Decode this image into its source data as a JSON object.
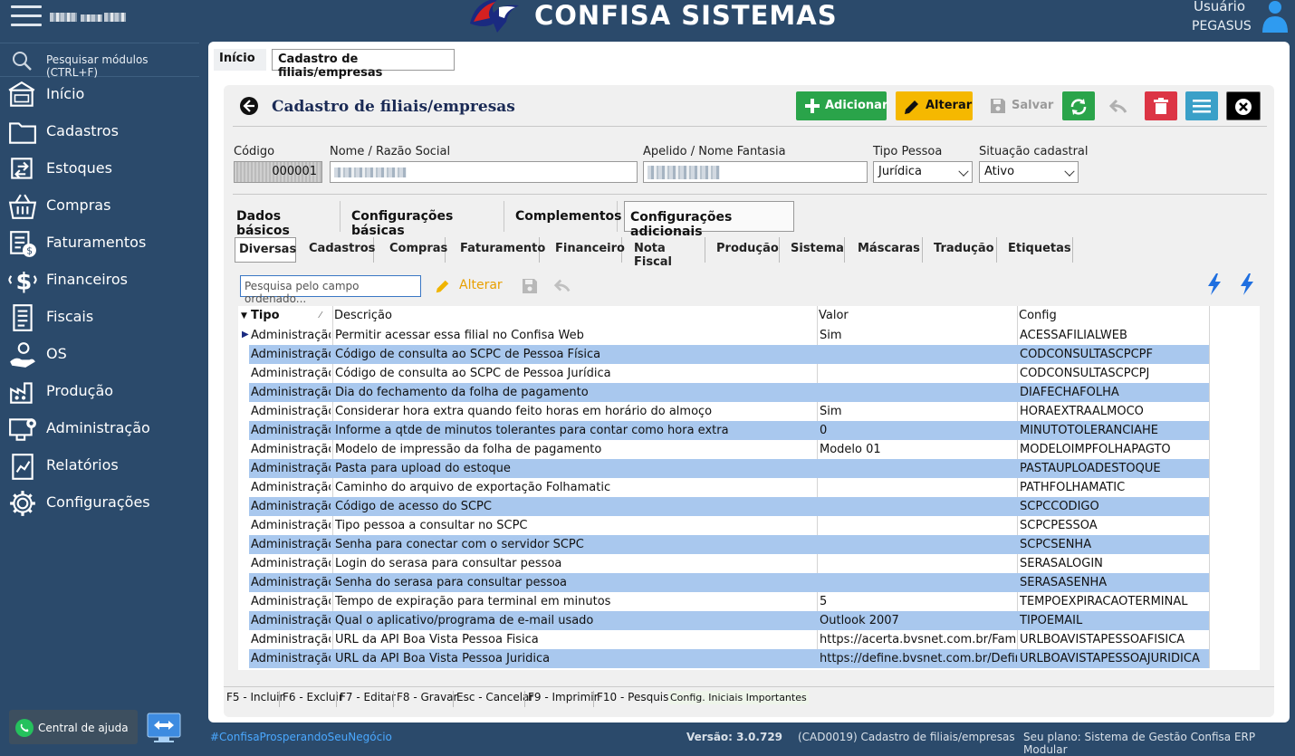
{
  "app": {
    "brand": "CONFISA SISTEMAS",
    "user_label": "Usuário",
    "user_name": "PEGASUS"
  },
  "sidebar": {
    "search_placeholder": "Pesquisar módulos (CTRL+F)",
    "items": [
      {
        "label": "Início",
        "icon": "home-icon"
      },
      {
        "label": "Cadastros",
        "icon": "folder-icon"
      },
      {
        "label": "Estoques",
        "icon": "stock-icon"
      },
      {
        "label": "Compras",
        "icon": "basket-icon"
      },
      {
        "label": "Faturamentos",
        "icon": "invoice-icon"
      },
      {
        "label": "Financeiros",
        "icon": "dollar-icon"
      },
      {
        "label": "Fiscais",
        "icon": "document-icon"
      },
      {
        "label": "OS",
        "icon": "service-order-icon"
      },
      {
        "label": "Produção",
        "icon": "factory-icon"
      },
      {
        "label": "Administração",
        "icon": "admin-icon"
      },
      {
        "label": "Relatórios",
        "icon": "report-icon"
      },
      {
        "label": "Configurações",
        "icon": "gear-icon"
      }
    ],
    "help_label": "Central de ajuda"
  },
  "tabs": {
    "home": "Início",
    "current": "Cadastro de filiais/empresas"
  },
  "page": {
    "title": "Cadastro de filiais/empresas"
  },
  "toolbar": {
    "add": "Adicionar",
    "edit": "Alterar",
    "save": "Salvar"
  },
  "colors": {
    "add": "#2aa44a",
    "edit": "#f5b800",
    "refresh": "#2aa44a",
    "delete": "#dc3545",
    "menu": "#3aa0c8",
    "close": "#000000",
    "row_alt": "#a9c8ee",
    "sidebar": "#2b4a6b"
  },
  "form": {
    "codigo_label": "Código",
    "codigo_value": "000001",
    "nome_label": "Nome / Razão Social",
    "apelido_label": "Apelido / Nome Fantasia",
    "tipo_label": "Tipo Pessoa",
    "tipo_value": "Jurídica",
    "situacao_label": "Situação cadastral",
    "situacao_value": "Ativo"
  },
  "main_tabs": [
    "Dados básicos",
    "Configurações básicas",
    "Complementos",
    "Configurações adicionais"
  ],
  "sub_tabs": [
    "Diversas",
    "Cadastros",
    "Compras",
    "Faturamento",
    "Financeiro",
    "Nota Fiscal",
    "Produção",
    "Sistema",
    "Máscaras",
    "Tradução",
    "Etiquetas"
  ],
  "grid": {
    "search_placeholder": "Pesquisa pelo campo ordenado...",
    "edit_label": "Alterar",
    "headers": {
      "tipo": "Tipo",
      "descricao": "Descrição",
      "valor": "Valor",
      "config": "Config"
    },
    "rows": [
      {
        "tipo": "Administração",
        "descricao": "Permitir acessar essa filial no Confisa Web",
        "valor": "Sim",
        "config": "ACESSAFILIALWEB"
      },
      {
        "tipo": "Administração",
        "descricao": "Código de consulta ao SCPC de Pessoa Física",
        "valor": "",
        "config": "CODCONSULTASCPCPF"
      },
      {
        "tipo": "Administração",
        "descricao": "Código de consulta ao SCPC de Pessoa Jurídica",
        "valor": "",
        "config": "CODCONSULTASCPCPJ"
      },
      {
        "tipo": "Administração",
        "descricao": "Dia do fechamento da folha de pagamento",
        "valor": "",
        "config": "DIAFECHAFOLHA"
      },
      {
        "tipo": "Administração",
        "descricao": "Considerar hora extra quando feito horas em horário do almoço",
        "valor": "Sim",
        "config": "HORAEXTRAALMOCO"
      },
      {
        "tipo": "Administração",
        "descricao": "Informe a qtde de minutos tolerantes para contar como hora extra",
        "valor": "0",
        "config": "MINUTOTOLERANCIAHE"
      },
      {
        "tipo": "Administração",
        "descricao": "Modelo de impressão da folha de pagamento",
        "valor": "Modelo 01",
        "config": "MODELOIMPFOLHAPAGTO"
      },
      {
        "tipo": "Administração",
        "descricao": "Pasta para upload do estoque",
        "valor": "",
        "config": "PASTAUPLOADESTOQUE"
      },
      {
        "tipo": "Administração",
        "descricao": "Caminho do arquivo de exportação Folhamatic",
        "valor": "",
        "config": "PATHFOLHAMATIC"
      },
      {
        "tipo": "Administração",
        "descricao": "Código de acesso do SCPC",
        "valor": "",
        "config": "SCPCCODIGO"
      },
      {
        "tipo": "Administração",
        "descricao": "Tipo pessoa a consultar no SCPC",
        "valor": "",
        "config": "SCPCPESSOA"
      },
      {
        "tipo": "Administração",
        "descricao": "Senha para conectar com o servidor SCPC",
        "valor": "",
        "config": "SCPCSENHA"
      },
      {
        "tipo": "Administração",
        "descricao": "Login do serasa para consultar pessoa",
        "valor": "",
        "config": "SERASALOGIN"
      },
      {
        "tipo": "Administração",
        "descricao": "Senha do serasa para consultar pessoa",
        "valor": "",
        "config": "SERASASENHA"
      },
      {
        "tipo": "Administração",
        "descricao": "Tempo de expiração para terminal em minutos",
        "valor": "5",
        "config": "TEMPOEXPIRACAOTERMINAL"
      },
      {
        "tipo": "Administração",
        "descricao": "Qual o aplicativo/programa de e-mail usado",
        "valor": "Outlook 2007",
        "config": "TIPOEMAIL"
      },
      {
        "tipo": "Administração",
        "descricao": "URL da API Boa Vista Pessoa Fisica",
        "valor": "https://acerta.bvsnet.com.br/FamiliaA",
        "config": "URLBOAVISTAPESSOAFISICA"
      },
      {
        "tipo": "Administração",
        "descricao": "URL da API Boa Vista Pessoa Juridica",
        "valor": "https://define.bvsnet.com.br/DefineXr",
        "config": "URLBOAVISTAPESSOAJURIDICA"
      }
    ]
  },
  "fkeys": [
    "F5 - Incluir",
    "F6 - Excluir",
    "F7 - Editar",
    "F8 - Gravar",
    "Esc - Cancelar",
    "F9 - Imprimir",
    "F10 - Pesquisa"
  ],
  "config_imp": "Config. Iniciais Importantes",
  "status": {
    "hashtag": "#ConfisaProsperandoSeuNegócio",
    "version": "Versão: 3.0.729",
    "screen": "(CAD0019) Cadastro de filiais/empresas",
    "plan": "Seu plano: Sistema de Gestão Confisa ERP Modular"
  }
}
